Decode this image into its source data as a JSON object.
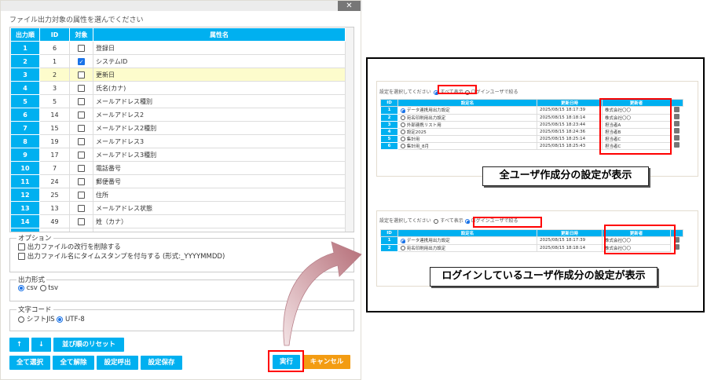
{
  "dialog": {
    "close_label": "✕",
    "heading": "ファイル出力対象の属性を選んでください",
    "columns": [
      "出力順",
      "ID",
      "対象",
      "属性名"
    ],
    "rows": [
      {
        "order": "1",
        "id": "6",
        "checked": false,
        "name": "登録日"
      },
      {
        "order": "2",
        "id": "1",
        "checked": true,
        "name": "システムID"
      },
      {
        "order": "3",
        "id": "2",
        "checked": false,
        "name": "更新日",
        "selected": true
      },
      {
        "order": "4",
        "id": "3",
        "checked": false,
        "name": "氏名(カナ)"
      },
      {
        "order": "5",
        "id": "5",
        "checked": false,
        "name": "メールアドレス種別"
      },
      {
        "order": "6",
        "id": "14",
        "checked": false,
        "name": "メールアドレス2"
      },
      {
        "order": "7",
        "id": "15",
        "checked": false,
        "name": "メールアドレス2種別"
      },
      {
        "order": "8",
        "id": "19",
        "checked": false,
        "name": "メールアドレス3"
      },
      {
        "order": "9",
        "id": "17",
        "checked": false,
        "name": "メールアドレス3種別"
      },
      {
        "order": "10",
        "id": "7",
        "checked": false,
        "name": "電話番号"
      },
      {
        "order": "11",
        "id": "24",
        "checked": false,
        "name": "郵便番号"
      },
      {
        "order": "12",
        "id": "25",
        "checked": false,
        "name": "住所"
      },
      {
        "order": "13",
        "id": "13",
        "checked": false,
        "name": "メールアドレス状態"
      },
      {
        "order": "14",
        "id": "49",
        "checked": false,
        "name": "姓（カナ）"
      }
    ],
    "options": {
      "legend": "オプション",
      "items": [
        "出力ファイルの改行を削除する",
        "出力ファイル名にタイムスタンプを付与する (形式:_YYYYMMDD)"
      ]
    },
    "format": {
      "legend": "出力形式",
      "options": [
        "csv",
        "tsv"
      ],
      "selected": "csv"
    },
    "encoding": {
      "legend": "文字コード",
      "options": [
        "シフトJIS",
        "UTF-8"
      ],
      "selected": "UTF-8"
    },
    "buttons": {
      "up": "↑",
      "down": "↓",
      "reset": "並び順のリセット",
      "select_all": "全て選択",
      "clear_all": "全て解除",
      "load": "設定呼出",
      "save": "設定保存",
      "run": "実行",
      "cancel": "キャンセル"
    }
  },
  "accent": "#00b0f0",
  "cancel_color": "#f39c12",
  "examples": [
    {
      "prompt": "設定を選択してください",
      "radio_all": "すべて表示",
      "radio_login": "ログインユーザで絞る",
      "selected": "all",
      "columns": [
        "ID",
        "設定名",
        "更新日時",
        "更新者"
      ],
      "rows": [
        {
          "id": "1",
          "name": "データ連携用出力設定",
          "date": "2025/08/15 18:17:39",
          "user": "株式会社〇〇",
          "selected": true
        },
        {
          "id": "2",
          "name": "宛名印刷用出力設定",
          "date": "2025/08/15 18:18:14",
          "user": "株式会社〇〇"
        },
        {
          "id": "3",
          "name": "外部連携リスト用",
          "date": "2025/08/15 18:23:44",
          "user": "担当者A"
        },
        {
          "id": "4",
          "name": "設定2025",
          "date": "2025/08/15 18:24:36",
          "user": "担当者B"
        },
        {
          "id": "5",
          "name": "集計用",
          "date": "2025/08/15 18:25:14",
          "user": "担当者C"
        },
        {
          "id": "6",
          "name": "集計用_8月",
          "date": "2025/08/15 18:25:43",
          "user": "担当者C"
        }
      ],
      "callout": "全ユーザ作成分の設定が表示"
    },
    {
      "prompt": "設定を選択してください",
      "radio_all": "すべて表示",
      "radio_login": "ログインユーザで絞る",
      "selected": "login",
      "columns": [
        "ID",
        "設定名",
        "更新日時",
        "更新者"
      ],
      "rows": [
        {
          "id": "1",
          "name": "データ連携用出力設定",
          "date": "2025/08/15 18:17:39",
          "user": "株式会社〇〇",
          "selected": true
        },
        {
          "id": "2",
          "name": "宛名印刷用出力設定",
          "date": "2025/08/15 18:18:14",
          "user": "株式会社〇〇"
        }
      ],
      "callout": "ログインしているユーザ作成分の設定が表示"
    }
  ]
}
